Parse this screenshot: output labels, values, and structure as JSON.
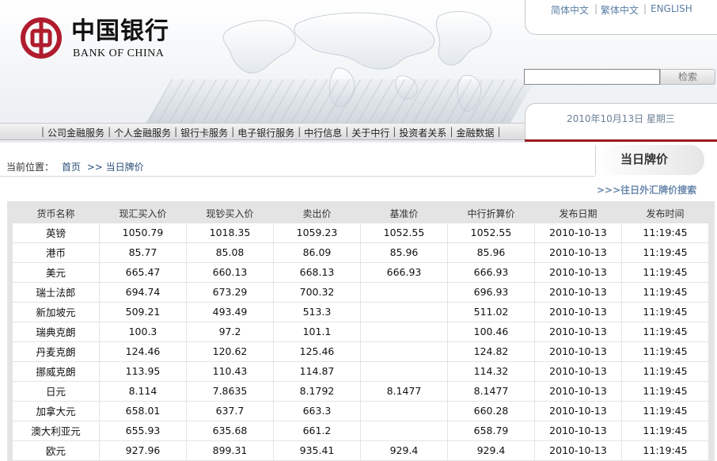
{
  "brand": {
    "name_cn": "中国银行",
    "name_en": "BANK OF CHINA",
    "primary_color": "#b01c2e"
  },
  "languages": [
    "简体中文",
    "繁体中文",
    "ENGLISH"
  ],
  "search": {
    "input_value": "",
    "button_label": "检索"
  },
  "nav": {
    "items": [
      "公司金融服务",
      "个人金融服务",
      "银行卡服务",
      "电子银行服务",
      "中行信息",
      "关于中行",
      "投资者关系",
      "金融数据"
    ]
  },
  "date_text": "2010年10月13日 星期三",
  "breadcrumb": {
    "prefix": "当前位置：",
    "home": "首页",
    "sep": ">>",
    "current": "当日牌价"
  },
  "page_title": "当日牌价",
  "fx_search_link": ">>>往日外汇牌价搜索",
  "table": {
    "headers": [
      "货币名称",
      "现汇买入价",
      "现钞买入价",
      "卖出价",
      "基准价",
      "中行折算价",
      "发布日期",
      "发布时间"
    ],
    "rows": [
      [
        "英镑",
        "1050.79",
        "1018.35",
        "1059.23",
        "1052.55",
        "1052.55",
        "2010-10-13",
        "11:19:45"
      ],
      [
        "港币",
        "85.77",
        "85.08",
        "86.09",
        "85.96",
        "85.96",
        "2010-10-13",
        "11:19:45"
      ],
      [
        "美元",
        "665.47",
        "660.13",
        "668.13",
        "666.93",
        "666.93",
        "2010-10-13",
        "11:19:45"
      ],
      [
        "瑞士法郎",
        "694.74",
        "673.29",
        "700.32",
        "",
        "696.93",
        "2010-10-13",
        "11:19:45"
      ],
      [
        "新加坡元",
        "509.21",
        "493.49",
        "513.3",
        "",
        "511.02",
        "2010-10-13",
        "11:19:45"
      ],
      [
        "瑞典克朗",
        "100.3",
        "97.2",
        "101.1",
        "",
        "100.46",
        "2010-10-13",
        "11:19:45"
      ],
      [
        "丹麦克朗",
        "124.46",
        "120.62",
        "125.46",
        "",
        "124.82",
        "2010-10-13",
        "11:19:45"
      ],
      [
        "挪威克朗",
        "113.95",
        "110.43",
        "114.87",
        "",
        "114.32",
        "2010-10-13",
        "11:19:45"
      ],
      [
        "日元",
        "8.114",
        "7.8635",
        "8.1792",
        "8.1477",
        "8.1477",
        "2010-10-13",
        "11:19:45"
      ],
      [
        "加拿大元",
        "658.01",
        "637.7",
        "663.3",
        "",
        "660.28",
        "2010-10-13",
        "11:19:45"
      ],
      [
        "澳大利亚元",
        "655.93",
        "635.68",
        "661.2",
        "",
        "658.79",
        "2010-10-13",
        "11:19:45"
      ],
      [
        "欧元",
        "927.96",
        "899.31",
        "935.41",
        "929.4",
        "929.4",
        "2010-10-13",
        "11:19:45"
      ]
    ]
  }
}
